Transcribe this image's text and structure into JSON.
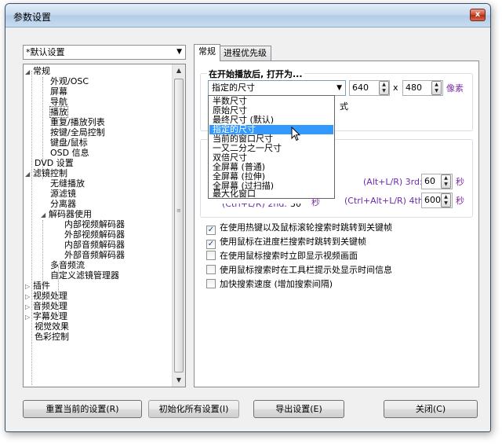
{
  "window": {
    "title": "参数设置",
    "close": "x"
  },
  "profile_combo": {
    "value": "*默认设置"
  },
  "tree": {
    "items": [
      {
        "label": "常规",
        "toggle": "◢"
      },
      {
        "label": "外观/OSC"
      },
      {
        "label": "屏幕"
      },
      {
        "label": "导航"
      },
      {
        "label": "播放"
      },
      {
        "label": "重复/播放列表"
      },
      {
        "label": "按键/全局控制"
      },
      {
        "label": "键盘/鼠标"
      },
      {
        "label": "OSD 信息"
      },
      {
        "label": "DVD 设置"
      },
      {
        "label": "滤镜控制",
        "toggle": "◢"
      },
      {
        "label": "无缝播放"
      },
      {
        "label": "源滤镜"
      },
      {
        "label": "分离器"
      },
      {
        "label": "解码器使用",
        "toggle": "◢"
      },
      {
        "label": "内部视频解码器"
      },
      {
        "label": "外部视频解码器"
      },
      {
        "label": "内部音频解码器"
      },
      {
        "label": "外部音频解码器"
      },
      {
        "label": "多音频流"
      },
      {
        "label": "自定义滤镜管理器"
      },
      {
        "label": "插件",
        "toggle": "▷"
      },
      {
        "label": "视频处理",
        "toggle": "▷"
      },
      {
        "label": "音频处理",
        "toggle": "▷"
      },
      {
        "label": "字幕处理",
        "toggle": "▷"
      },
      {
        "label": "视觉效果"
      },
      {
        "label": "色彩控制"
      }
    ]
  },
  "tabs": [
    {
      "label": "常规"
    },
    {
      "label": "进程优先级"
    }
  ],
  "open_group": {
    "title": "在开始播放后, 打开为...",
    "size_select": "指定的尺寸",
    "width": "640",
    "x_label": "x",
    "height": "480",
    "unit": "像素",
    "partial_text": "式"
  },
  "dropdown": {
    "options": [
      "半数尺寸",
      "原始尺寸",
      "最终尺寸 (默认)",
      "指定的尺寸",
      "当前的窗口尺寸",
      "一又二分之一尺寸",
      "双倍尺寸",
      "全屏幕 (普通)",
      "全屏幕 (拉伸)",
      "全屏幕 (过扫描)",
      "最大化窗口"
    ],
    "highlighted": "指定的尺寸"
  },
  "seek_group": {
    "third_label": "(Alt+L/R) 3rd:",
    "third_value": "60",
    "third_unit": "秒",
    "second_label_partial": "(Ctrl+L/R) 2nd:",
    "second_value_partial": "30",
    "second_unit": "秒",
    "fourth_label": "(Ctrl+Alt+L/R) 4th:",
    "fourth_value": "600",
    "fourth_unit": "秒"
  },
  "checkboxes": [
    {
      "label": "在使用热键以及鼠标滚轮搜索时跳转到关键帧",
      "checked": true,
      "mark": "✓"
    },
    {
      "label": "使用鼠标在进度栏搜索时跳转到关键帧",
      "checked": true,
      "mark": "✓"
    },
    {
      "label": "在使用鼠标搜索时立即显示视频画面",
      "checked": false,
      "mark": ""
    },
    {
      "label": "使用鼠标搜索时在工具栏提示处显示时间信息",
      "checked": false,
      "mark": ""
    },
    {
      "label": "加快搜索速度 (增加搜索间隔)",
      "checked": false,
      "mark": ""
    }
  ],
  "buttons": {
    "reset": "重置当前的设置(R)",
    "init_all": "初始化所有设置(I)",
    "export": "导出设置(E)",
    "close": "关闭(C)"
  },
  "colors": {
    "highlight": "#3399ff",
    "accent_purple": "#7d2ea6"
  }
}
